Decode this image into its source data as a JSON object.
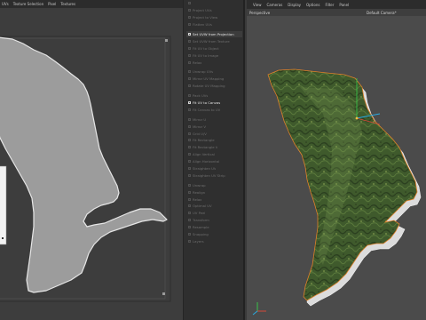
{
  "uv_editor": {
    "menus": [
      "UVs",
      "Texture Selection",
      "Pixel",
      "Textures"
    ]
  },
  "uv_commands": {
    "items": [
      {
        "label": "",
        "active": false
      },
      {
        "label": "Project UVs",
        "active": false
      },
      {
        "label": "Project to View",
        "active": false
      },
      {
        "label": "Flatten UVs",
        "active": false
      },
      {
        "sep": true
      },
      {
        "label": "Set UVW from Projection",
        "active": true,
        "highlight": true
      },
      {
        "label": "Set UVW from Texture",
        "active": false
      },
      {
        "label": "Fit UV to Object",
        "active": false
      },
      {
        "label": "Fit UV to Image",
        "active": false
      },
      {
        "label": "Relax",
        "active": false
      },
      {
        "sep": true
      },
      {
        "label": "Unwrap UVs",
        "active": false
      },
      {
        "label": "Mirror UV Mapping",
        "active": false
      },
      {
        "label": "Rotate UV Mapping",
        "active": false
      },
      {
        "sep": true
      },
      {
        "label": "Pack UVs",
        "active": false
      },
      {
        "label": "Fit UV to Canvas",
        "active": true
      },
      {
        "label": "Fit Canvas to UV",
        "active": false
      },
      {
        "sep": true
      },
      {
        "label": "Mirror U",
        "active": false
      },
      {
        "label": "Mirror V",
        "active": false
      },
      {
        "label": "Grid U/V",
        "active": false
      },
      {
        "label": "Fit Rectangle",
        "active": false
      },
      {
        "label": "Fit Rectangle V",
        "active": false
      },
      {
        "label": "Align Vertical",
        "active": false
      },
      {
        "label": "Align Horizontal",
        "active": false
      },
      {
        "label": "Straighten UV",
        "active": false
      },
      {
        "label": "Straighten UV Strip",
        "active": false
      },
      {
        "sep": true
      },
      {
        "label": "Unwrap",
        "active": false
      },
      {
        "label": "Realign",
        "active": false
      },
      {
        "label": "Relax",
        "active": false
      },
      {
        "label": "Optimal UV",
        "active": false
      },
      {
        "label": "UV Peel",
        "active": false
      },
      {
        "label": "Transform",
        "active": false
      },
      {
        "label": "Resample",
        "active": false
      },
      {
        "label": "Snapping",
        "active": false
      },
      {
        "label": "Layers",
        "active": false
      }
    ]
  },
  "viewport": {
    "menus": [
      "View",
      "Cameras",
      "Display",
      "Options",
      "Filter",
      "Panel"
    ],
    "title": "Perspective",
    "camera": "Default Camera*"
  },
  "colors": {
    "uv_shape_fill": "#9c9c9c",
    "uv_shape_stroke": "#e6e6e6",
    "terrain_green": "#3f5a2c",
    "terrain_dark": "#2c4020",
    "extrude_side": "#d8d8d8",
    "selection_orange": "#e0802a"
  }
}
